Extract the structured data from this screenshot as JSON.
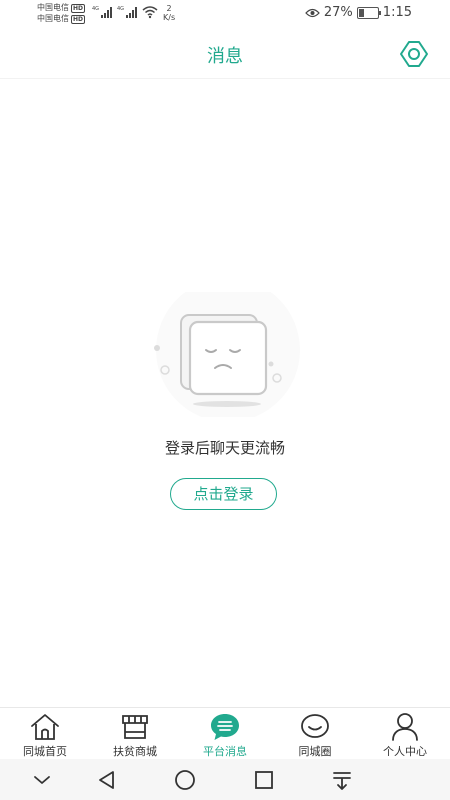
{
  "status_bar": {
    "carrier_1": "中国电信",
    "carrier_2": "中国电信",
    "hd": "HD",
    "network": "4G",
    "speed_value": "2",
    "speed_unit": "K/s",
    "battery_percent": "27%",
    "battery_level": 0.27,
    "time": "1:15"
  },
  "header": {
    "title": "消息",
    "settings_icon": "gear-icon"
  },
  "empty_state": {
    "message": "登录后聊天更流畅",
    "login_button": "点击登录",
    "icon": "sad-face-card-icon"
  },
  "tab_bar": {
    "items": [
      {
        "label": "同城首页",
        "icon": "home-icon",
        "active": false
      },
      {
        "label": "扶贫商城",
        "icon": "store-icon",
        "active": false
      },
      {
        "label": "平台消息",
        "icon": "message-bubble-icon",
        "active": true
      },
      {
        "label": "同城圈",
        "icon": "circle-chat-icon",
        "active": false
      },
      {
        "label": "个人中心",
        "icon": "person-icon",
        "active": false
      }
    ]
  },
  "system_nav": {
    "buttons": [
      "collapse-icon",
      "back-icon",
      "home-circle-icon",
      "recents-icon",
      "pull-down-icon"
    ]
  },
  "colors": {
    "accent": "#21a98e",
    "text": "#333333",
    "background": "#ffffff"
  }
}
